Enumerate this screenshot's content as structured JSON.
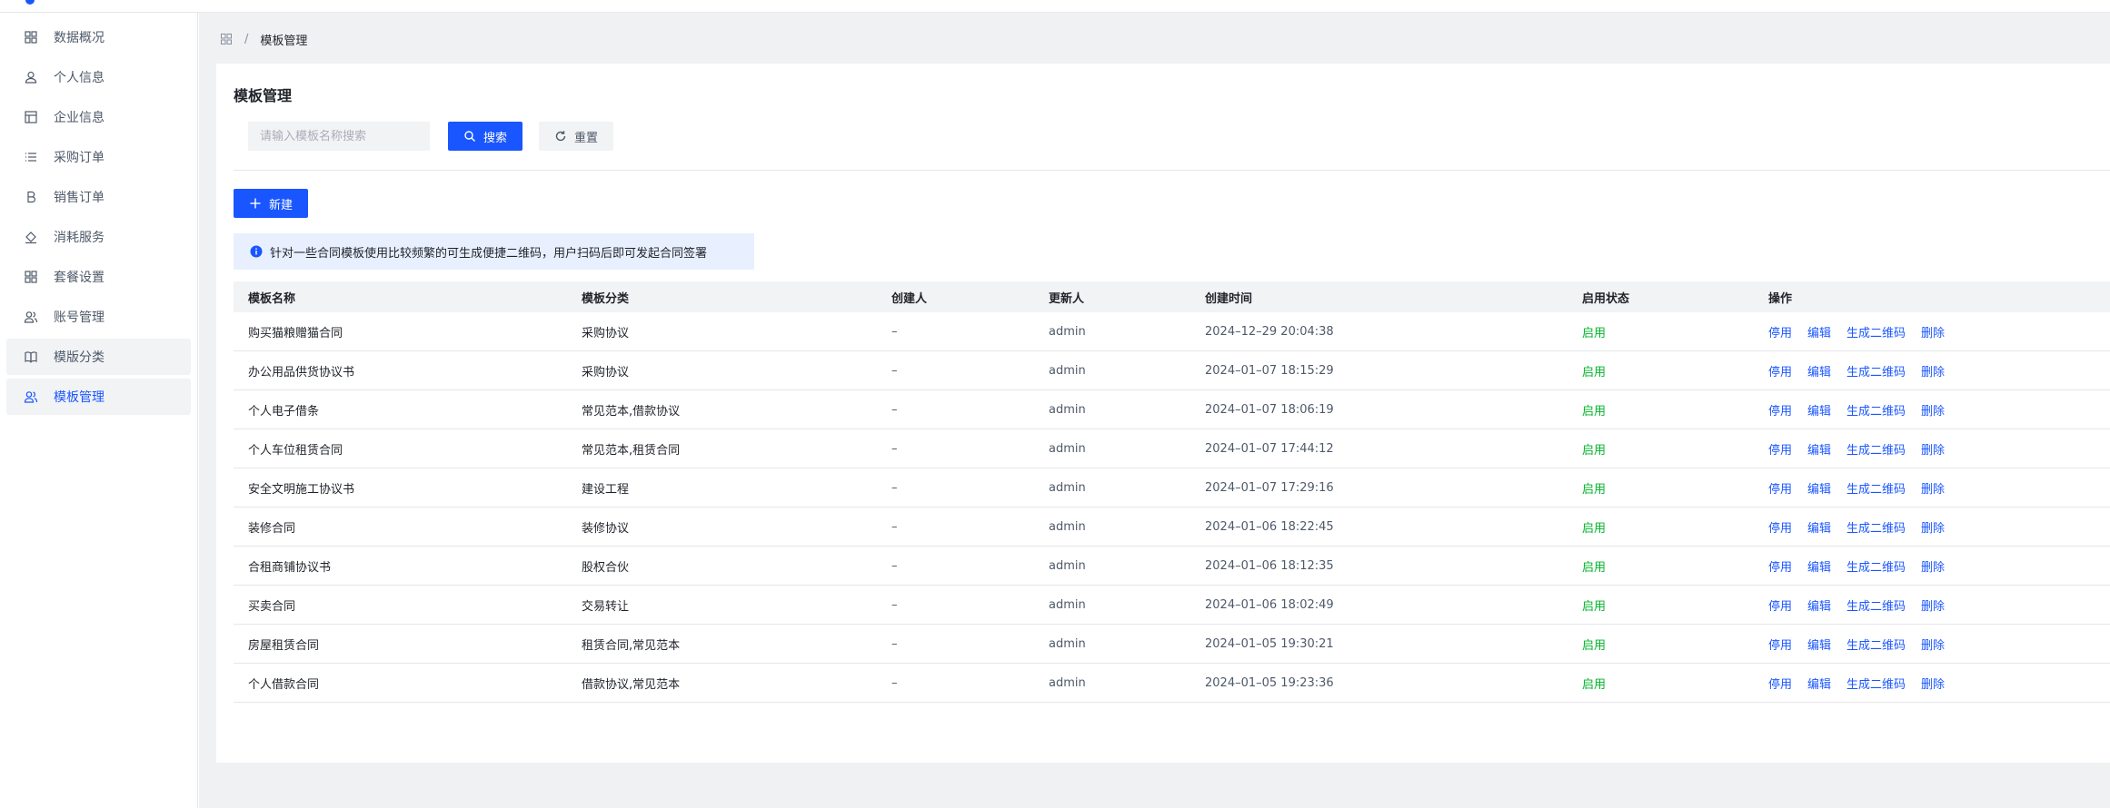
{
  "sidebar": {
    "items": [
      {
        "label": "数据概况",
        "icon": "grid-icon"
      },
      {
        "label": "个人信息",
        "icon": "user-icon"
      },
      {
        "label": "企业信息",
        "icon": "layout-icon"
      },
      {
        "label": "采购订单",
        "icon": "list-icon"
      },
      {
        "label": "销售订单",
        "icon": "bold-b-icon"
      },
      {
        "label": "消耗服务",
        "icon": "paint-bucket-icon"
      },
      {
        "label": "套餐设置",
        "icon": "apps-icon"
      },
      {
        "label": "账号管理",
        "icon": "user-group-icon"
      },
      {
        "label": "模版分类",
        "icon": "book-icon"
      },
      {
        "label": "模板管理",
        "icon": "user-group-icon"
      }
    ]
  },
  "breadcrumb": {
    "current": "模板管理"
  },
  "page": {
    "title": "模板管理",
    "search_placeholder": "请输入模板名称搜索",
    "search_label": "搜索",
    "reset_label": "重置",
    "new_label": "新建",
    "notice": "针对一些合同模板使用比较频繁的可生成便捷二维码，用户扫码后即可发起合同签署"
  },
  "table": {
    "columns": [
      "模板名称",
      "模板分类",
      "创建人",
      "更新人",
      "创建时间",
      "启用状态",
      "操作"
    ],
    "actions": [
      "停用",
      "编辑",
      "生成二维码",
      "删除"
    ],
    "rows": [
      {
        "name": "购买猫粮赠猫合同",
        "category": "采购协议",
        "creator": "–",
        "updater": "admin",
        "created": "2024–12–29 20:04:38",
        "status": "启用"
      },
      {
        "name": "办公用品供货协议书",
        "category": "采购协议",
        "creator": "–",
        "updater": "admin",
        "created": "2024–01–07 18:15:29",
        "status": "启用"
      },
      {
        "name": "个人电子借条",
        "category": "常见范本,借款协议",
        "creator": "–",
        "updater": "admin",
        "created": "2024–01–07 18:06:19",
        "status": "启用"
      },
      {
        "name": "个人车位租赁合同",
        "category": "常见范本,租赁合同",
        "creator": "–",
        "updater": "admin",
        "created": "2024–01–07 17:44:12",
        "status": "启用"
      },
      {
        "name": "安全文明施工协议书",
        "category": "建设工程",
        "creator": "–",
        "updater": "admin",
        "created": "2024–01–07 17:29:16",
        "status": "启用"
      },
      {
        "name": "装修合同",
        "category": "装修协议",
        "creator": "–",
        "updater": "admin",
        "created": "2024–01–06 18:22:45",
        "status": "启用"
      },
      {
        "name": "合租商铺协议书",
        "category": "股权合伙",
        "creator": "–",
        "updater": "admin",
        "created": "2024–01–06 18:12:35",
        "status": "启用"
      },
      {
        "name": "买卖合同",
        "category": "交易转让",
        "creator": "–",
        "updater": "admin",
        "created": "2024–01–06 18:02:49",
        "status": "启用"
      },
      {
        "name": "房屋租赁合同",
        "category": "租赁合同,常见范本",
        "creator": "–",
        "updater": "admin",
        "created": "2024–01–05 19:30:21",
        "status": "启用"
      },
      {
        "name": "个人借款合同",
        "category": "借款协议,常见范本",
        "creator": "–",
        "updater": "admin",
        "created": "2024–01–05 19:23:36",
        "status": "启用"
      }
    ]
  },
  "colors": {
    "primary": "#1a56ff",
    "success": "#00b42a",
    "page_bg": "#f0f1f3"
  }
}
